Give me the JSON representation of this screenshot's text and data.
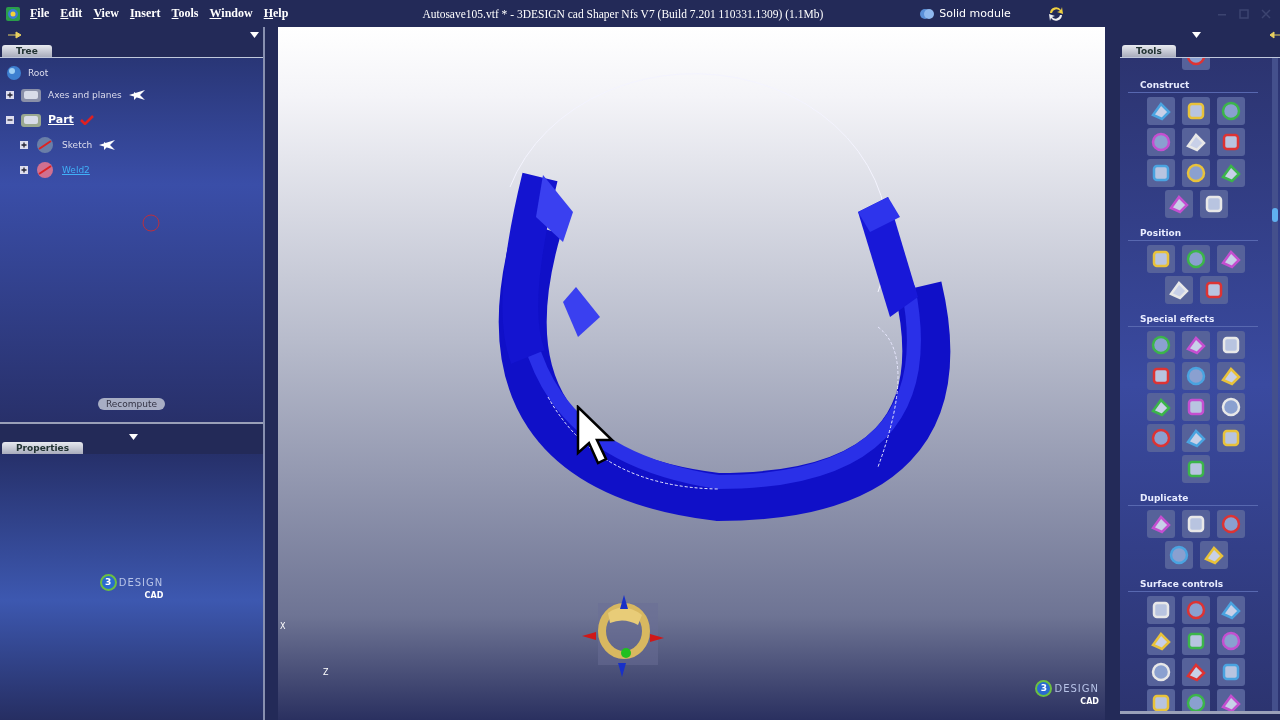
{
  "menu": [
    {
      "label": "File"
    },
    {
      "label": "Edit"
    },
    {
      "label": "View"
    },
    {
      "label": "Insert"
    },
    {
      "label": "Tools"
    },
    {
      "label": "Window"
    },
    {
      "label": "Help"
    }
  ],
  "window": {
    "title": "Autosave105.vtf * -  3DESIGN cad Shaper Nfs V7  (Build 7.201 110331.1309)  (1.1Mb)",
    "module": "Solid module"
  },
  "tree_panel": {
    "tab": "Tree",
    "root": "Root",
    "items": [
      {
        "label": "Axes and planes",
        "expanded": false,
        "pinned": true,
        "checked": false,
        "current": false,
        "link": false
      },
      {
        "label": "Part",
        "expanded": true,
        "pinned": false,
        "checked": true,
        "current": true,
        "link": false,
        "children": [
          {
            "label": "Sketch",
            "expanded": false,
            "pinned": true,
            "checked": false,
            "current": false,
            "link": false
          },
          {
            "label": "Weld2",
            "expanded": false,
            "pinned": false,
            "checked": false,
            "current": false,
            "link": true
          }
        ]
      }
    ],
    "button": "Recompute"
  },
  "properties_panel": {
    "tab": "Properties"
  },
  "logo": {
    "mark": "3",
    "word": "DESIGN",
    "sub": "CAD"
  },
  "viewport": {
    "axis_x": "X",
    "axis_z": "Z",
    "logo": {
      "mark": "3",
      "word": "DESIGN",
      "sub": "CAD"
    }
  },
  "tools_panel": {
    "tab": "Tools",
    "groups": [
      {
        "rows": [
          [
            {
              "kind": "tool"
            }
          ]
        ]
      },
      {
        "title": "Construct",
        "rows": [
          [
            {
              "kind": "tool"
            },
            {
              "kind": "tool"
            },
            {
              "kind": "tool"
            }
          ],
          [
            {
              "kind": "tool"
            },
            {
              "kind": "tool"
            },
            {
              "kind": "tool"
            }
          ],
          [
            {
              "kind": "tool"
            },
            {
              "kind": "tool"
            },
            {
              "kind": "tool"
            }
          ],
          [
            {
              "kind": "tool"
            },
            {
              "kind": "tool"
            }
          ]
        ]
      },
      {
        "title": "Position",
        "rows": [
          [
            {
              "kind": "tool"
            },
            {
              "kind": "tool"
            },
            {
              "kind": "tool"
            }
          ],
          [
            {
              "kind": "tool"
            },
            {
              "kind": "tool"
            }
          ]
        ]
      },
      {
        "title": "Special effects",
        "rows": [
          [
            {
              "kind": "tool"
            },
            {
              "kind": "tool"
            },
            {
              "kind": "tool"
            }
          ],
          [
            {
              "kind": "tool"
            },
            {
              "kind": "tool"
            },
            {
              "kind": "tool"
            }
          ],
          [
            {
              "kind": "tool"
            },
            {
              "kind": "tool"
            },
            {
              "kind": "tool"
            }
          ],
          [
            {
              "kind": "tool"
            },
            {
              "kind": "tool"
            },
            {
              "kind": "tool"
            }
          ],
          [
            {
              "kind": "tool"
            }
          ]
        ]
      },
      {
        "title": "Duplicate",
        "rows": [
          [
            {
              "kind": "tool"
            },
            {
              "kind": "tool"
            },
            {
              "kind": "tool"
            }
          ],
          [
            {
              "kind": "tool"
            },
            {
              "kind": "tool"
            }
          ]
        ]
      },
      {
        "title": "Surface controls",
        "rows": [
          [
            {
              "kind": "tool"
            },
            {
              "kind": "tool"
            },
            {
              "kind": "tool"
            }
          ],
          [
            {
              "kind": "tool"
            },
            {
              "kind": "tool"
            },
            {
              "kind": "tool"
            }
          ],
          [
            {
              "kind": "tool"
            },
            {
              "kind": "tool"
            },
            {
              "kind": "tool"
            }
          ],
          [
            {
              "kind": "tool"
            },
            {
              "kind": "tool"
            },
            {
              "kind": "tool"
            }
          ]
        ]
      }
    ]
  }
}
